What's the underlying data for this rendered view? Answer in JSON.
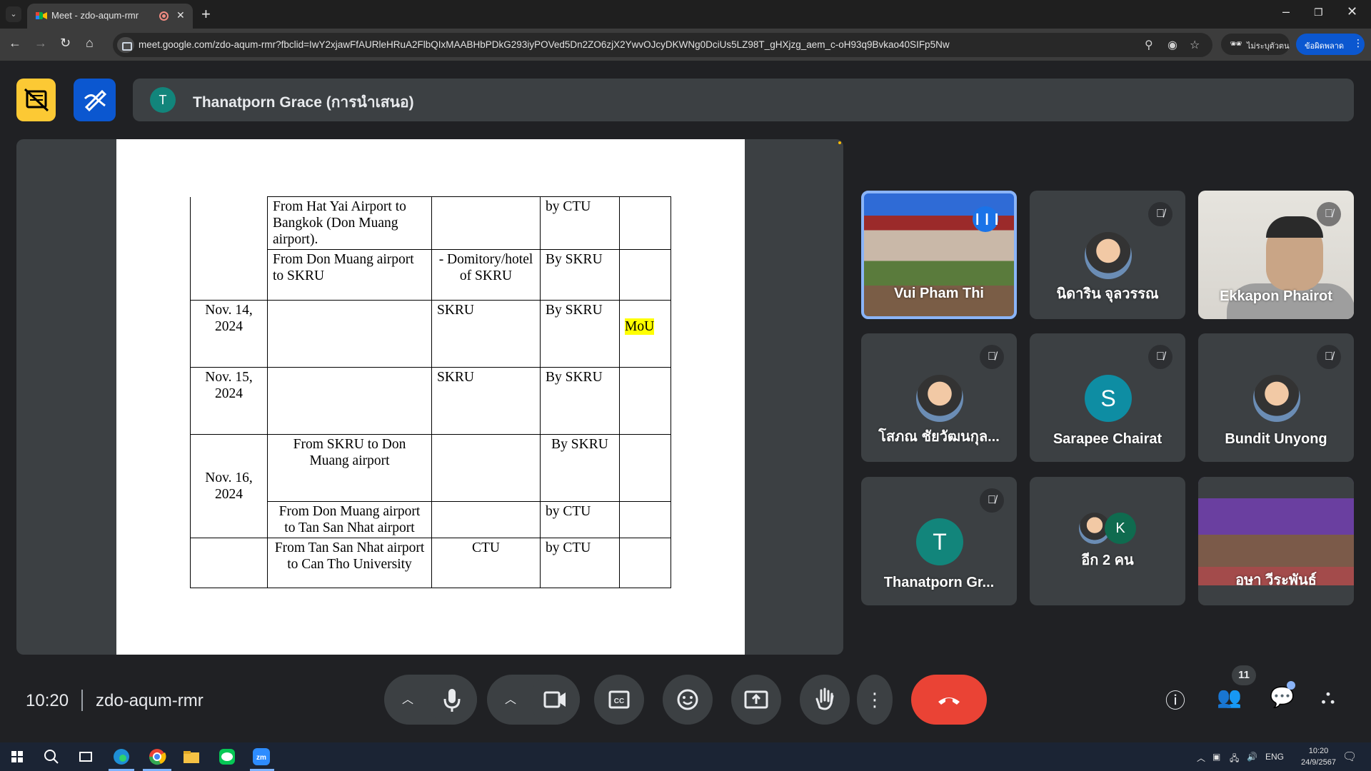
{
  "browser": {
    "tab_title": "Meet - zdo-aqum-rmr",
    "url": "meet.google.com/zdo-aqum-rmr?fbclid=IwY2xjawFfAURleHRuA2FlbQIxMAABHbPDkG293iyPOVed5Dn2ZO6zjX2YwvOJcyDKWNg0DciUs5LZ98T_gHXjzg_aem_c-oH93q9Bvkao40SIFp5Nw",
    "incognito_label": "ไม่ระบุตัวตน",
    "profile_label": "ข้อผิดพลาด"
  },
  "meet": {
    "presenter_initial": "T",
    "presenter_title": "Thanatporn Grace (การนำเสนอ)",
    "time": "10:20",
    "meeting_code": "zdo-aqum-rmr",
    "participant_count": "11"
  },
  "document": {
    "rows": [
      {
        "date": "",
        "route": "From Hat Yai Airport to Bangkok (Don Muang airport).",
        "accommodation": "",
        "transport": "by CTU",
        "note": ""
      },
      {
        "date": "",
        "route": "From Don Muang airport to SKRU",
        "accommodation": "- Domitory/hotel of SKRU",
        "transport": "By  SKRU",
        "note": ""
      },
      {
        "date": "Nov. 14, 2024",
        "route": "",
        "accommodation": "SKRU",
        "transport": "By SKRU",
        "note": "MoU"
      },
      {
        "date": "Nov. 15, 2024",
        "route": "",
        "accommodation": "SKRU",
        "transport": "By SKRU",
        "note": ""
      },
      {
        "date": "Nov. 16, 2024",
        "route": "From SKRU to Don Muang airport",
        "accommodation": "",
        "transport": "By SKRU",
        "note": ""
      },
      {
        "date": "",
        "route": "From Don Muang airport to Tan San Nhat airport",
        "accommodation": "",
        "transport": "by CTU",
        "note": ""
      },
      {
        "date": "",
        "route": "From Tan San Nhat airport to Can Tho University",
        "accommodation": "CTU",
        "transport": "by CTU",
        "note": ""
      }
    ]
  },
  "participants": [
    {
      "name": "Vui Pham Thi",
      "initial": ""
    },
    {
      "name": "นิดาริน จุลวรรณ",
      "initial": ""
    },
    {
      "name": "Ekkapon Phairot",
      "initial": ""
    },
    {
      "name": "โสภณ ชัยวัฒนกุล...",
      "initial": ""
    },
    {
      "name": "Sarapee Chairat",
      "initial": "S"
    },
    {
      "name": "Bundit Unyong",
      "initial": ""
    },
    {
      "name": "Thanatporn Gr...",
      "initial": "T"
    },
    {
      "name": "อีก 2 คน",
      "initial": "K"
    },
    {
      "name": "อุษา วีระพันธ์",
      "initial": ""
    }
  ],
  "taskbar": {
    "lang": "ENG",
    "time": "10:20",
    "date": "24/9/2567"
  },
  "colors": {
    "meet_bg": "#202124",
    "tile_bg": "#3c4043",
    "leave_red": "#ea4335",
    "accent_blue": "#8ab4f8",
    "highlight_yellow": "#ffff00"
  }
}
